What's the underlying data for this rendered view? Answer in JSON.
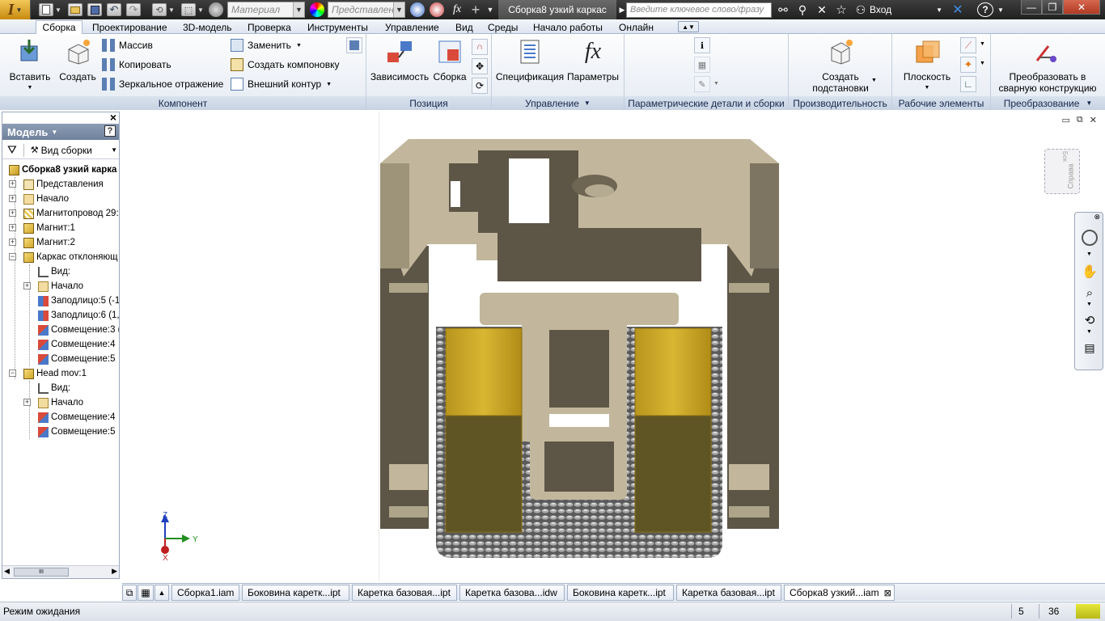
{
  "titlebar": {
    "app_letter": "I",
    "material_placeholder": "Материал",
    "representation_placeholder": "Представлен",
    "fx_label": "fx",
    "document_title": "Сборка8 узкий каркас",
    "search_placeholder": "Введите ключевое слово/фразу",
    "signin_label": "Вход",
    "help_label": "?",
    "close_label": "✕"
  },
  "ribbon": {
    "tabs": [
      "Сборка",
      "Проектирование",
      "3D-модель",
      "Проверка",
      "Инструменты",
      "Управление",
      "Вид",
      "Среды",
      "Начало работы",
      "Онлайн"
    ],
    "active_tab": 0,
    "panels": {
      "component": {
        "title": "Компонент",
        "insert_label": "Вставить",
        "create_label": "Создать",
        "pattern_label": "Массив",
        "copy_label": "Копировать",
        "mirror_label": "Зеркальное отражение",
        "replace_label": "Заменить",
        "create_layout_label": "Создать компоновку",
        "shrinkwrap_label": "Внешний контур"
      },
      "position": {
        "title": "Позиция",
        "constrain_label": "Зависимость",
        "assemble_label": "Сборка"
      },
      "manage": {
        "title": "Управление",
        "bom_label": "Спецификация",
        "params_label": "Параметры",
        "fx_glyph": "fx"
      },
      "productivity": {
        "title": "Параметрические детали и сборки"
      },
      "productivity2": {
        "title": "Производительность",
        "create_sub_label_1": "Создать",
        "create_sub_label_2": "подстановки"
      },
      "work_features": {
        "title": "Рабочие элементы",
        "plane_label": "Плоскость"
      },
      "convert": {
        "title": "Преобразование",
        "convert_label_1": "Преобразовать в",
        "convert_label_2": "сварную конструкцию"
      }
    }
  },
  "browser": {
    "header": "Модель",
    "help_label": "?",
    "view_label": "Вид сборки",
    "close_label": "×",
    "scroll_grip": "III",
    "tree": [
      {
        "label": "Сборка8 узкий карка",
        "level": 0,
        "icon": "assembly-icon",
        "expand": "minus",
        "bold": true
      },
      {
        "label": "Представления",
        "level": 1,
        "icon": "representations-icon",
        "expand": "plus"
      },
      {
        "label": "Начало",
        "level": 1,
        "icon": "folder-icon",
        "expand": "plus"
      },
      {
        "label": "Магнитопровод 29:",
        "level": 1,
        "icon": "part-crossed-icon",
        "expand": "plus"
      },
      {
        "label": "Магнит:1",
        "level": 1,
        "icon": "part-icon",
        "expand": "plus"
      },
      {
        "label": "Магнит:2",
        "level": 1,
        "icon": "part-icon",
        "expand": "plus"
      },
      {
        "label": "Каркас отклоняющ",
        "level": 1,
        "icon": "part-icon",
        "expand": "minus"
      },
      {
        "label": "Вид:",
        "level": 2,
        "icon": "view-icon",
        "expand": "none"
      },
      {
        "label": "Начало",
        "level": 2,
        "icon": "folder-icon",
        "expand": "plus"
      },
      {
        "label": "Заподлицо:5 (-1",
        "level": 2,
        "icon": "flush-constraint-icon",
        "expand": "none"
      },
      {
        "label": "Заподлицо:6 (1,",
        "level": 2,
        "icon": "flush-constraint-icon",
        "expand": "none"
      },
      {
        "label": "Совмещение:3 (",
        "level": 2,
        "icon": "mate-constraint-icon",
        "expand": "none"
      },
      {
        "label": "Совмещение:4",
        "level": 2,
        "icon": "mate-constraint-icon",
        "expand": "none"
      },
      {
        "label": "Совмещение:5",
        "level": 2,
        "icon": "mate-constraint-icon",
        "expand": "none"
      },
      {
        "label": "Head mov:1",
        "level": 1,
        "icon": "part-icon",
        "expand": "minus"
      },
      {
        "label": "Вид:",
        "level": 2,
        "icon": "view-icon",
        "expand": "none"
      },
      {
        "label": "Начало",
        "level": 2,
        "icon": "folder-icon",
        "expand": "plus"
      },
      {
        "label": "Совмещение:4",
        "level": 2,
        "icon": "mate-constraint-icon",
        "expand": "none"
      },
      {
        "label": "Совмещение:5",
        "level": 2,
        "icon": "mate-constraint-icon",
        "expand": "none"
      }
    ]
  },
  "viewcube": {
    "face_label": "Справа",
    "top_label": "Бок"
  },
  "triad": {
    "z_label": "Z",
    "y_label": "Y",
    "x_label": "X"
  },
  "document_tabs": {
    "tabs": [
      "Сборка1.iam",
      "Боковина каретк...ipt",
      "Каретка базовая...ipt",
      "Каретка базова...idw",
      "Боковина каретк...ipt",
      "Каретка базовая...ipt",
      "Сборка8 узкий...iam"
    ],
    "active": 6,
    "close_glyph": "⊠"
  },
  "status": {
    "text": "Режим ожидания",
    "count1": "5",
    "count2": "36"
  },
  "colors": {
    "ribbon_title": "#15284b",
    "part_beige": "#c2b79c",
    "part_dark": "#5d5647",
    "magnet_yellow": "#c9a52a"
  }
}
